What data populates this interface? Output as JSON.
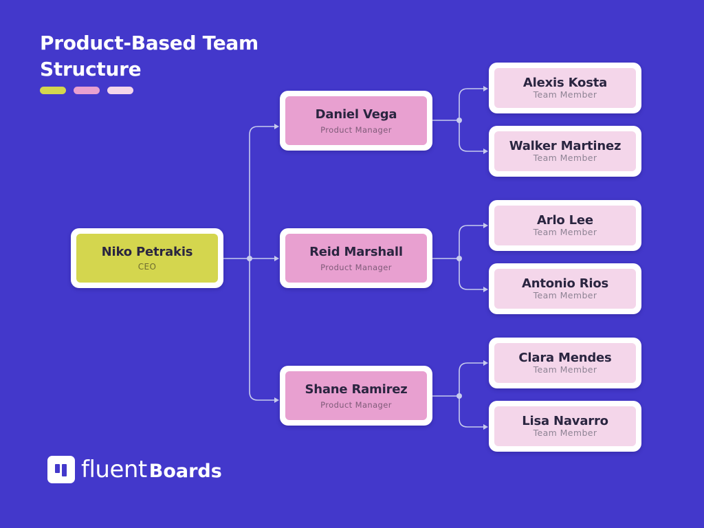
{
  "title": "Product-Based Team Structure",
  "legend_pills": [
    {
      "name": "ceo-color",
      "color": "#D4D64E"
    },
    {
      "name": "manager-color",
      "color": "#E8A0D0"
    },
    {
      "name": "member-color",
      "color": "#F4D6EA"
    }
  ],
  "colors": {
    "background": "#4338CB",
    "connector": "#C8CCEE",
    "ceo": "#D4D64E",
    "manager": "#E8A0D0",
    "member": "#F4D6EA"
  },
  "ceo": {
    "name": "Niko Petrakis",
    "role": "CEO"
  },
  "managers": [
    {
      "name": "Daniel Vega",
      "role": "Product Manager",
      "members": [
        {
          "name": "Alexis Kosta",
          "role": "Team Member"
        },
        {
          "name": "Walker Martinez",
          "role": "Team Member"
        }
      ]
    },
    {
      "name": "Reid Marshall",
      "role": "Product Manager",
      "members": [
        {
          "name": "Arlo Lee",
          "role": "Team Member"
        },
        {
          "name": "Antonio Rios",
          "role": "Team Member"
        }
      ]
    },
    {
      "name": "Shane Ramirez",
      "role": "Product Manager",
      "members": [
        {
          "name": "Clara Mendes",
          "role": "Team Member"
        },
        {
          "name": "Lisa Navarro",
          "role": "Team Member"
        }
      ]
    }
  ],
  "brand": {
    "logo_icon": "boards-icon",
    "part1": "fluent",
    "part2": "Boards"
  }
}
